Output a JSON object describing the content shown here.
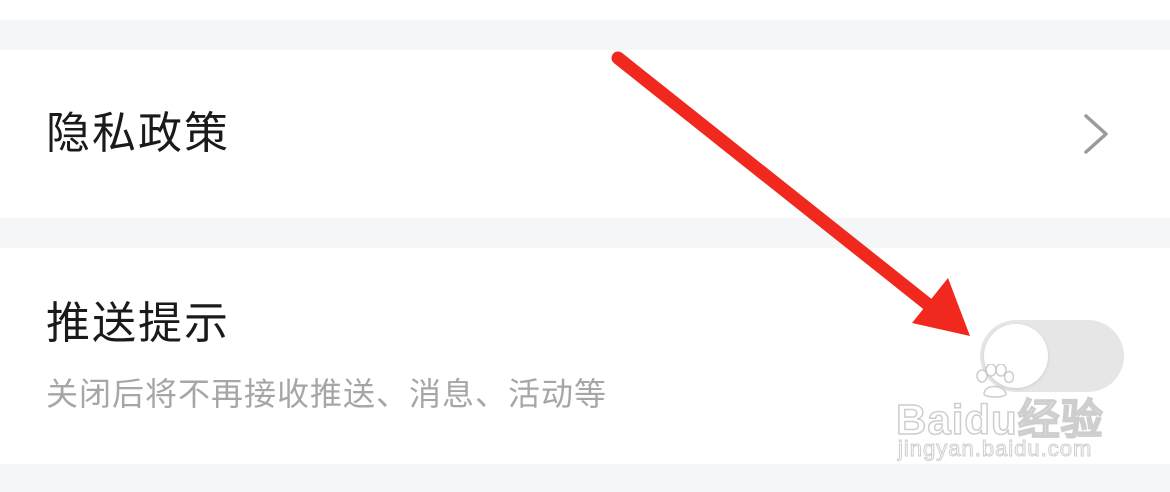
{
  "settings": {
    "privacy": {
      "title": "隐私政策"
    },
    "push": {
      "title": "推送提示",
      "subtitle": "关闭后将不再接收推送、消息、活动等",
      "enabled": false
    }
  },
  "icons": {
    "privacy_chevron": "chevron-right-icon"
  },
  "watermark": {
    "logo": "Baidu经验",
    "url": "jingyan.baidu.com"
  },
  "colors": {
    "background": "#f5f6f7",
    "row": "#ffffff",
    "title": "#1a1a1a",
    "subtitle": "#a6a6a6",
    "toggle_off": "#e6e6e6",
    "arrow": "#f0281e"
  }
}
